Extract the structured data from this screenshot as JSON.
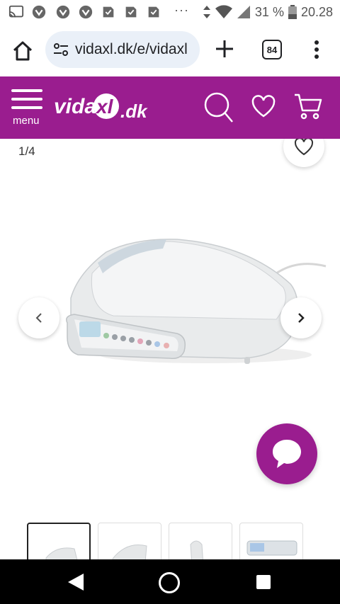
{
  "status_bar": {
    "icons": [
      "cast-icon",
      "notification-app-icon",
      "notification-app-icon",
      "notification-app-icon",
      "notification-app-icon",
      "notification-app-icon",
      "notification-app-icon"
    ],
    "more": "···",
    "battery_percent": "31 %",
    "time": "20.28"
  },
  "browser": {
    "url": "vidaxl.dk/e/vidaxl",
    "tab_count": "84"
  },
  "header": {
    "menu_label": "menu",
    "logo_text_left": "vida",
    "logo_text_mid": "xl",
    "logo_text_right": ".dk",
    "brand_color": "#9a1d8f"
  },
  "gallery": {
    "counter": "1/4",
    "current_index": 1,
    "total": 4,
    "thumbnails": [
      {
        "name": "thumbnail-1",
        "active": true
      },
      {
        "name": "thumbnail-2",
        "active": false
      },
      {
        "name": "thumbnail-3",
        "active": false
      },
      {
        "name": "thumbnail-4",
        "active": false
      }
    ]
  }
}
